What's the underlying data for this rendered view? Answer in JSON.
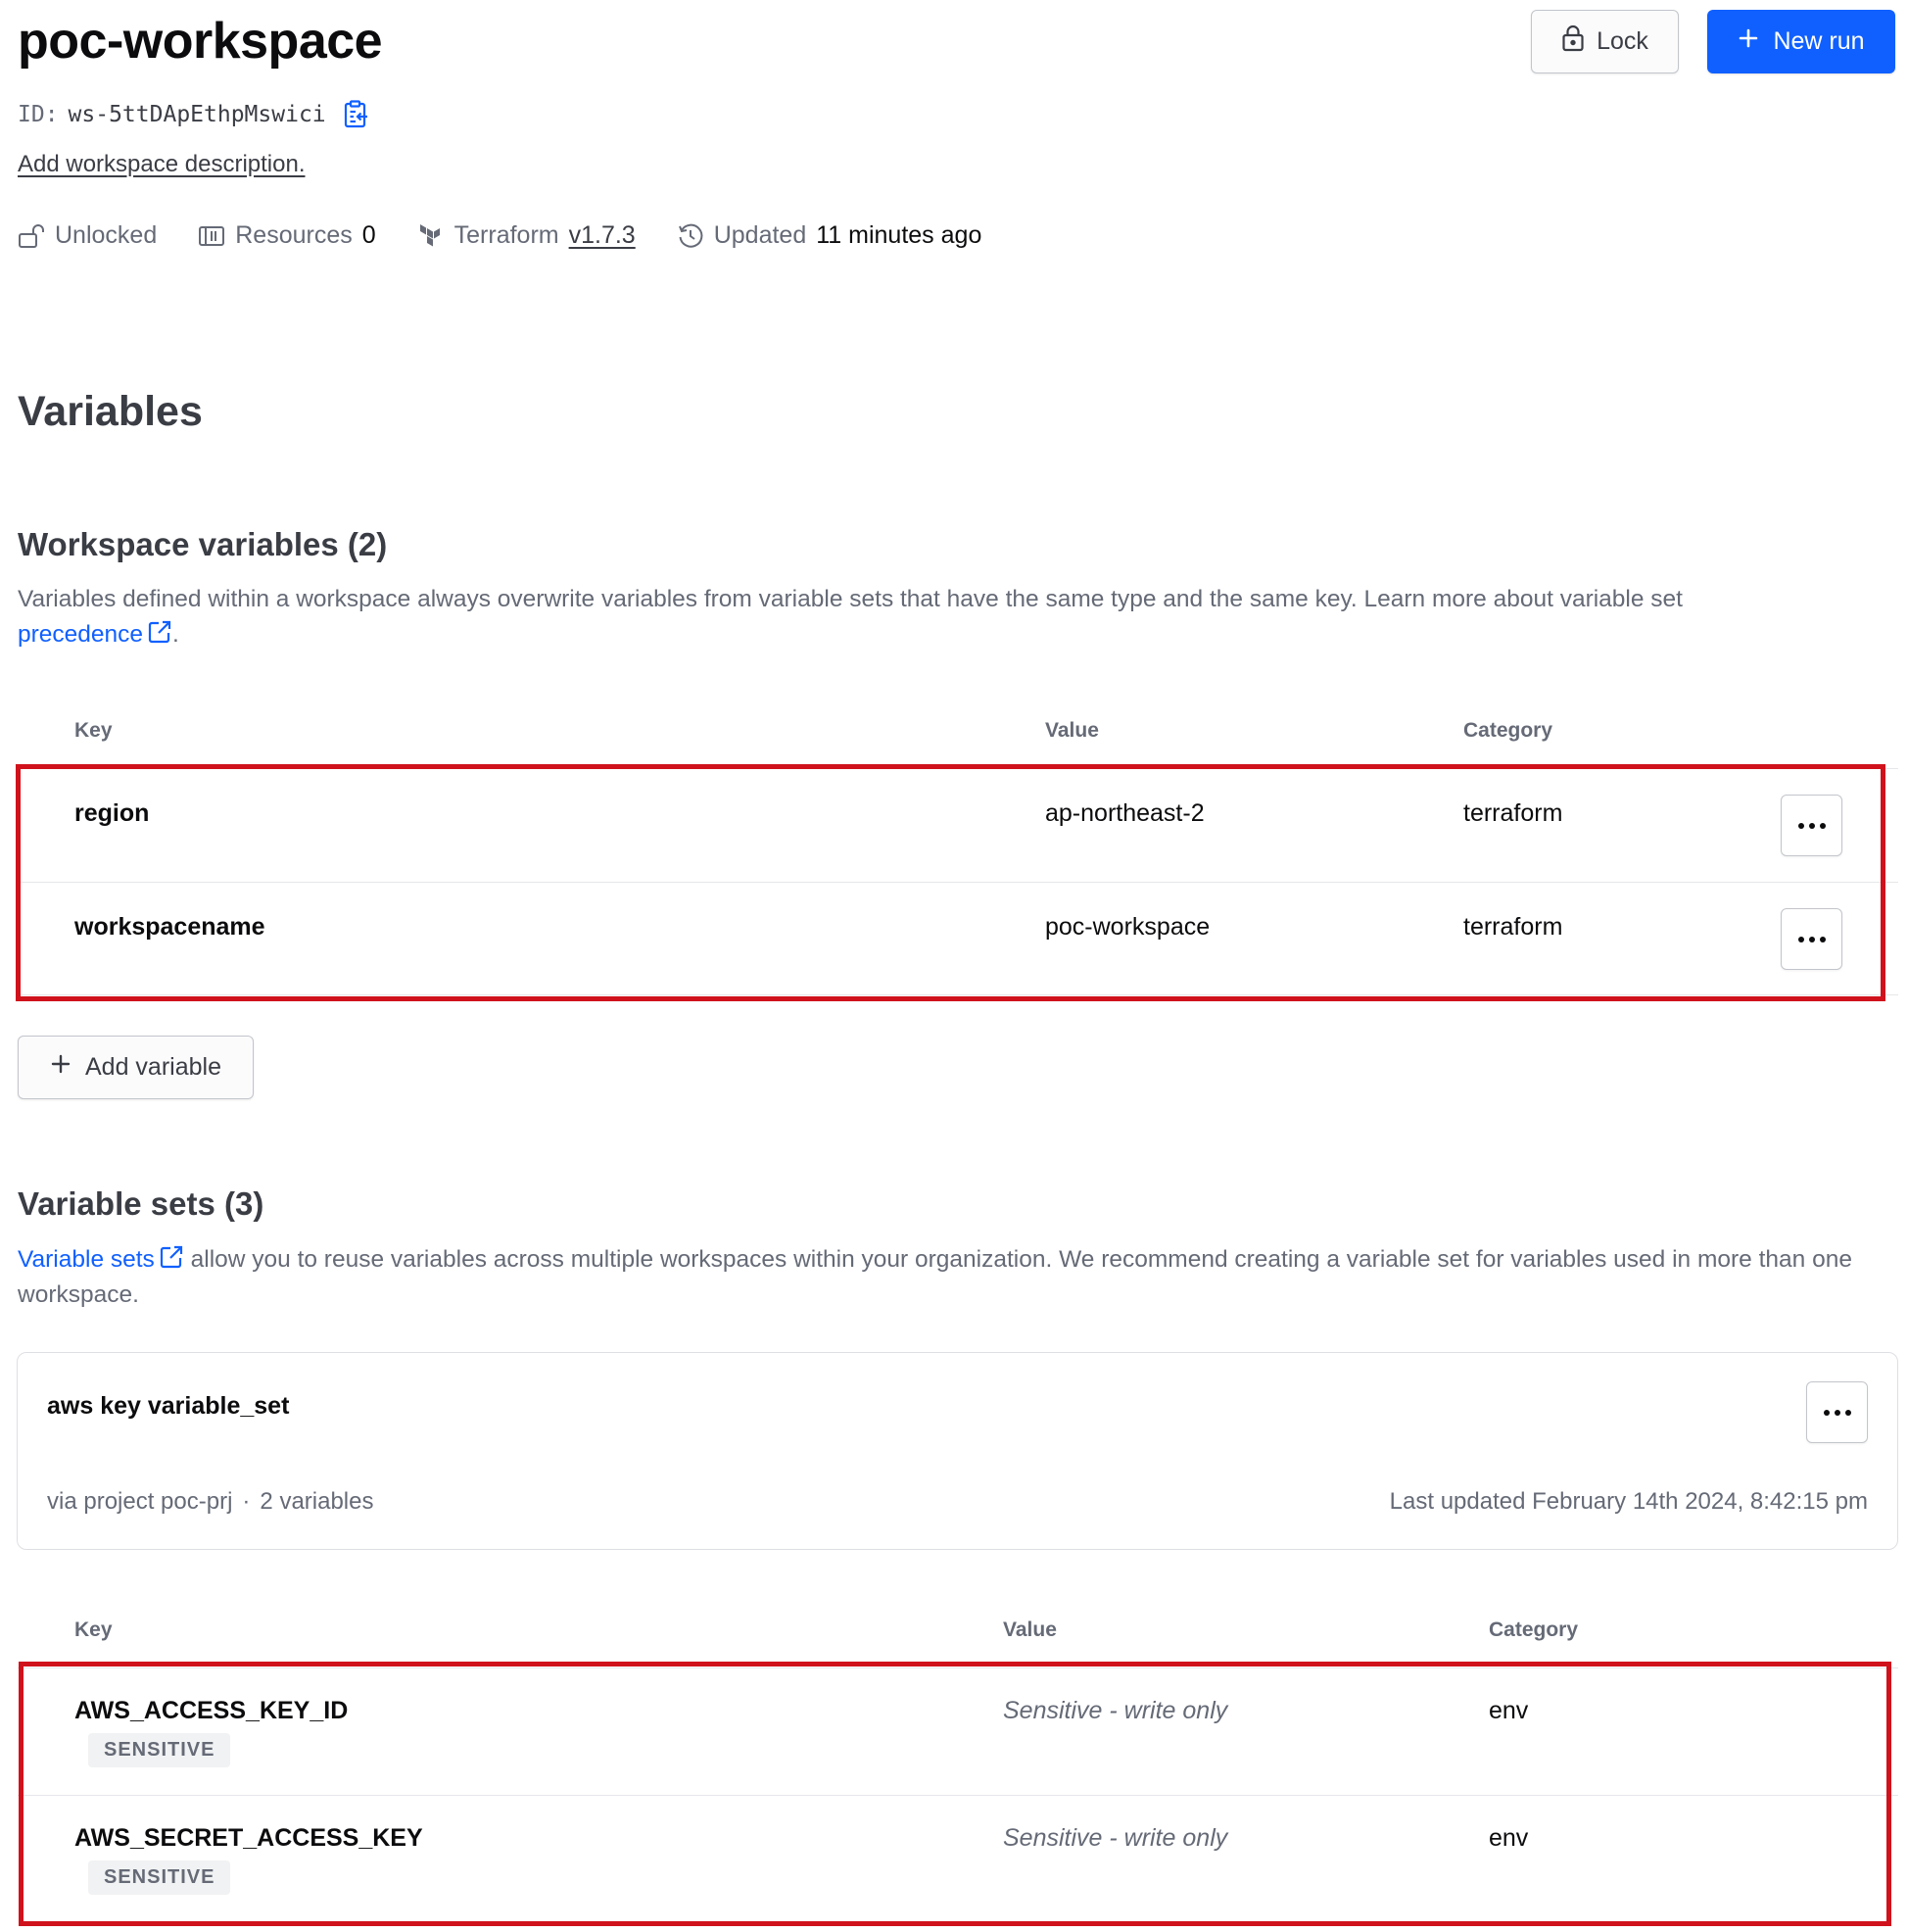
{
  "header": {
    "title": "poc-workspace",
    "id_label": "ID:",
    "id_value": "ws-5ttDApEthpMswici",
    "add_description": "Add workspace description.",
    "lock_button": "Lock",
    "new_run_button": "New run"
  },
  "meta": {
    "lock_status": "Unlocked",
    "resources_label": "Resources",
    "resources_count": "0",
    "terraform_label": "Terraform",
    "terraform_version": "v1.7.3",
    "updated_label": "Updated",
    "updated_value": "11 minutes ago"
  },
  "page_heading": "Variables",
  "workspace_variables": {
    "heading": "Workspace variables (2)",
    "description": "Variables defined within a workspace always overwrite variables from variable sets that have the same type and the same key. Learn more about variable set ",
    "link": "precedence",
    "description_end": ".",
    "columns": {
      "key": "Key",
      "value": "Value",
      "category": "Category"
    },
    "rows": [
      {
        "key": "region",
        "value": "ap-northeast-2",
        "category": "terraform"
      },
      {
        "key": "workspacename",
        "value": "poc-workspace",
        "category": "terraform"
      }
    ],
    "add_button": "Add variable"
  },
  "variable_sets": {
    "heading": "Variable sets (3)",
    "link": "Variable sets",
    "description": " allow you to reuse variables across multiple workspaces within your organization. We recommend creating a variable set for variables used in more than one workspace.",
    "card": {
      "name": "aws key variable_set",
      "via": "via project poc-prj",
      "separator": "·",
      "count": "2 variables",
      "last_updated": "Last updated February 14th 2024, 8:42:15 pm"
    },
    "columns": {
      "key": "Key",
      "value": "Value",
      "category": "Category"
    },
    "rows": [
      {
        "key": "AWS_ACCESS_KEY_ID",
        "badge": "SENSITIVE",
        "value": "Sensitive - write only",
        "category": "env"
      },
      {
        "key": "AWS_SECRET_ACCESS_KEY",
        "badge": "SENSITIVE",
        "value": "Sensitive - write only",
        "category": "env"
      }
    ]
  },
  "colors": {
    "primary": "#1060ff",
    "highlight_border": "#d0121c",
    "text_muted": "#656a76"
  }
}
